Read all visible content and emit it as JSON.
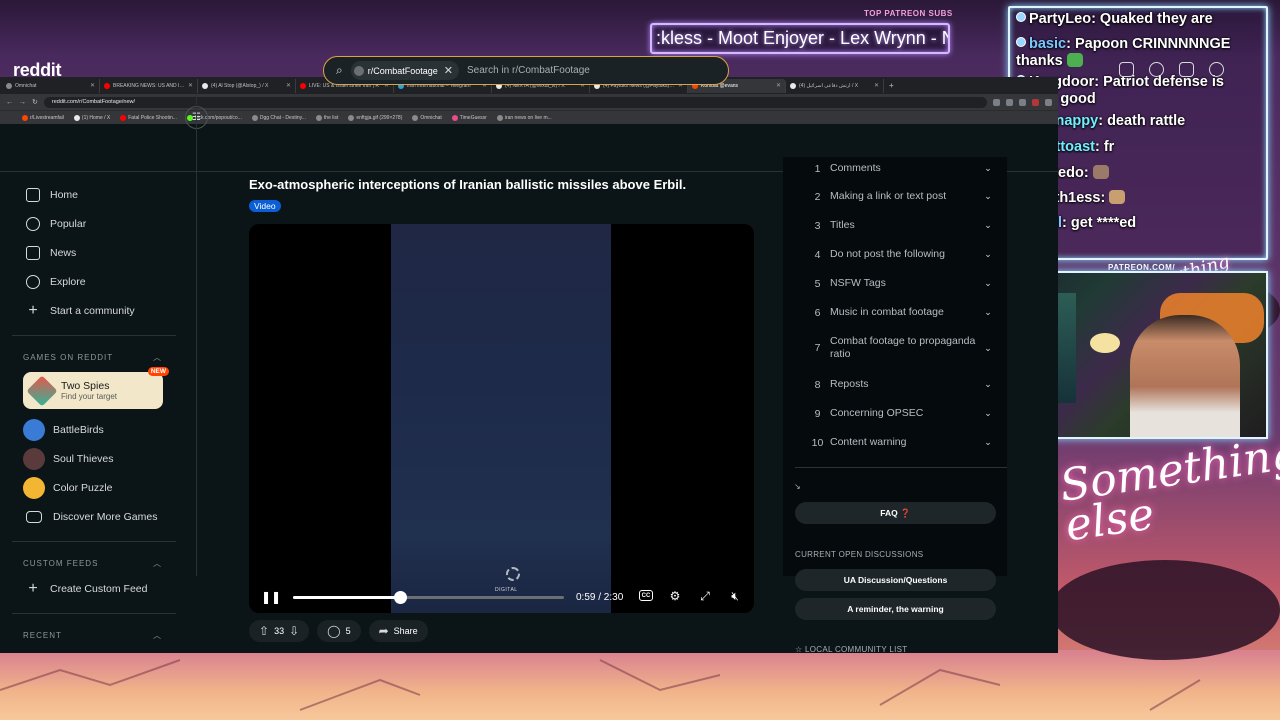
{
  "overlay": {
    "top_patreon_label": "TOP PATREON SUBS",
    "patreon_ticker": ":kless - Moot Enjoyer - Lex Wrynn - Ni",
    "patreon_small": "PATREON.COM/",
    "signature_small": "Anything else?",
    "signature": "Something else"
  },
  "chat": [
    {
      "name": "PartyLeo",
      "text": "Quaked they are",
      "platform": "twitch"
    },
    {
      "name": "basic",
      "text": "Papoon CRINNNNNGE thanks",
      "platform": "twitch"
    },
    {
      "name": "Kragdoor",
      "text": "Patriot defense is pretty good",
      "platform": "twitch"
    },
    {
      "name": "Knappy",
      "text": "death rattle",
      "platform": "kick"
    },
    {
      "name": "Bttoast",
      "text": "fr",
      "platform": "kick"
    },
    {
      "name": "makedo",
      "text": "",
      "platform": "kick"
    },
    {
      "name": "Tooth1ess",
      "text": "",
      "platform": "twitch"
    },
    {
      "name": "izuul",
      "text": "get ****ed",
      "platform": "twitch"
    }
  ],
  "browser": {
    "tabs": [
      {
        "title": "Omnichat",
        "color": "#8a8a8a"
      },
      {
        "title": "BREAKING NEWS: US AND ISR",
        "color": "#ff0000"
      },
      {
        "title": "(4) Al Stop (@Alstop_) / X",
        "color": "#e7e9ea"
      },
      {
        "title": "LIVE: US & Israel strike Iran | R",
        "color": "#ff0000"
      },
      {
        "title": "Iran International – Telegram",
        "color": "#2aa3df"
      },
      {
        "title": "(4) NEXTA (@nexta_tv) / X",
        "color": "#e7e9ea"
      },
      {
        "title": "(4) Faytuks News (@Faytuks) / X",
        "color": "#e7e9ea"
      },
      {
        "title": "Kombat @evans",
        "color": "#ff4500"
      },
      {
        "title": "(4) ارتش دفاعی اسرائیل / X",
        "color": "#e7e9ea"
      }
    ],
    "active_tab_index": 7,
    "url": "reddit.com/r/CombatFootage/new/",
    "bookmarks": [
      {
        "label": "r/Livestreamfail",
        "color": "#ff4500"
      },
      {
        "label": "(1) Home / X",
        "color": "#e7e9ea"
      },
      {
        "label": "Fatal Police Shootin...",
        "color": "#ff0000"
      },
      {
        "label": "kick.com/popout/co...",
        "color": "#53fc18"
      },
      {
        "label": "Dgg Chat - Destiny...",
        "color": "#8a8a8a"
      },
      {
        "label": "the list",
        "color": "#8a8a8a"
      },
      {
        "label": "enftgja.gif (299×278)",
        "color": "#8a8a8a"
      },
      {
        "label": "Omnichat",
        "color": "#8a8a8a"
      },
      {
        "label": "TimeGuessr",
        "color": "#e94b8b"
      },
      {
        "label": "iran news on live m...",
        "color": "#8a8a8a"
      }
    ]
  },
  "reddit": {
    "logo": "reddit",
    "search_chip": "r/CombatFootage",
    "search_placeholder": "Search in r/CombatFootage",
    "nav": [
      {
        "label": "Home",
        "icon": "home-icon"
      },
      {
        "label": "Popular",
        "icon": "popular-icon"
      },
      {
        "label": "News",
        "icon": "news-icon"
      },
      {
        "label": "Explore",
        "icon": "explore-icon"
      },
      {
        "label": "Start a community",
        "icon": "plus-icon"
      }
    ],
    "games_heading": "GAMES ON REDDIT",
    "featured_game": {
      "title": "Two Spies",
      "subtitle": "Find your target",
      "badge": "NEW"
    },
    "games": [
      {
        "label": "BattleBirds",
        "color": "#3a7bd5"
      },
      {
        "label": "Soul Thieves",
        "color": "#5a3a3a"
      },
      {
        "label": "Color Puzzle",
        "color": "#f2b632"
      },
      {
        "label": "Discover More Games",
        "color": "#d7dadc"
      }
    ],
    "custom_feeds_heading": "CUSTOM FEEDS",
    "create_custom_feed": "Create Custom Feed",
    "recent_heading": "RECENT",
    "post": {
      "title": "Exo-atmospheric interceptions of Iranian ballistic missiles above Erbil.",
      "flair": "Video",
      "video_time": "0:59 / 2:30",
      "progress": 0.393,
      "watermark": "DIGITAL",
      "votes": "33",
      "comments": "5",
      "share": "Share"
    },
    "rules": [
      {
        "num": "1",
        "text": "Comments"
      },
      {
        "num": "2",
        "text": "Making a link or text post"
      },
      {
        "num": "3",
        "text": "Titles"
      },
      {
        "num": "4",
        "text": "Do not post the following"
      },
      {
        "num": "5",
        "text": "NSFW Tags"
      },
      {
        "num": "6",
        "text": "Music in combat footage"
      },
      {
        "num": "7",
        "text": "Combat footage to propaganda ratio"
      },
      {
        "num": "8",
        "text": "Reposts"
      },
      {
        "num": "9",
        "text": "Concerning OPSEC"
      },
      {
        "num": "10",
        "text": "Content warning"
      }
    ],
    "faq_button": "FAQ ❓",
    "open_discussions_heading": "CURRENT OPEN DISCUSSIONS",
    "discussion_buttons": [
      "UA Discussion/Questions",
      "A reminder, the warning"
    ],
    "local_community_heading": "☆ LOCAL COMMUNITY LIST"
  }
}
